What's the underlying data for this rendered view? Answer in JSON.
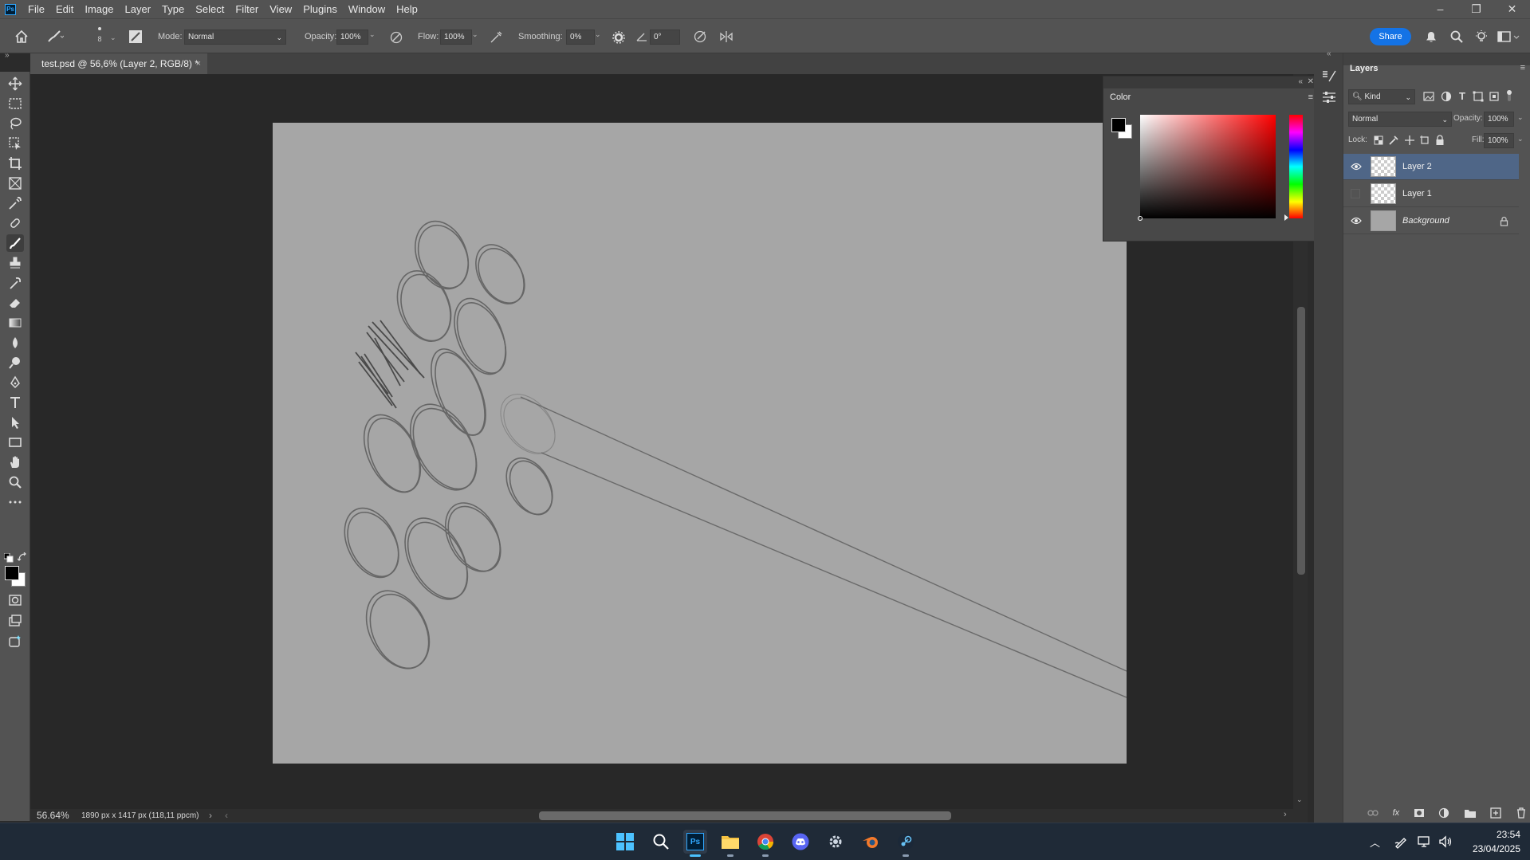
{
  "app": {
    "logo_text": "Ps"
  },
  "menu": [
    "File",
    "Edit",
    "Image",
    "Layer",
    "Type",
    "Select",
    "Filter",
    "View",
    "Plugins",
    "Window",
    "Help"
  ],
  "window_controls": {
    "minimize": "–",
    "restore": "❐",
    "close": "✕"
  },
  "options_bar": {
    "brush_size": "8",
    "mode_label": "Mode:",
    "mode_value": "Normal",
    "opacity_label": "Opacity:",
    "opacity_value": "100%",
    "flow_label": "Flow:",
    "flow_value": "100%",
    "smoothing_label": "Smoothing:",
    "smoothing_value": "0%",
    "angle_value": "0°",
    "share_label": "Share"
  },
  "document_tab": {
    "title": "test.psd @ 56,6% (Layer 2, RGB/8) *",
    "close": "×"
  },
  "status_bar": {
    "zoom": "56.64%",
    "doc_info": "1890 px x 1417 px (118,11 ppcm)"
  },
  "color_panel": {
    "title": "Color",
    "foreground": "#000000",
    "background": "#ffffff"
  },
  "layers_panel": {
    "title": "Layers",
    "filter_label": "Kind",
    "blend_mode": "Normal",
    "opacity_label": "Opacity:",
    "opacity_value": "100%",
    "lock_label": "Lock:",
    "fill_label": "Fill:",
    "fill_value": "100%",
    "layers": [
      {
        "name": "Layer 2",
        "visible": true,
        "selected": true
      },
      {
        "name": "Layer 1",
        "visible": false,
        "selected": false
      },
      {
        "name": "Background",
        "visible": true,
        "selected": false,
        "locked": true
      }
    ]
  },
  "taskbar": {
    "apps": [
      "windows-start",
      "search",
      "photoshop",
      "file-explorer",
      "chrome",
      "discord",
      "settings",
      "blender",
      "steam"
    ],
    "time": "23:54",
    "date": "23/04/2025"
  },
  "colors": {
    "accent": "#1473e6",
    "selection": "#4f6687",
    "canvas": "#a6a6a6"
  }
}
